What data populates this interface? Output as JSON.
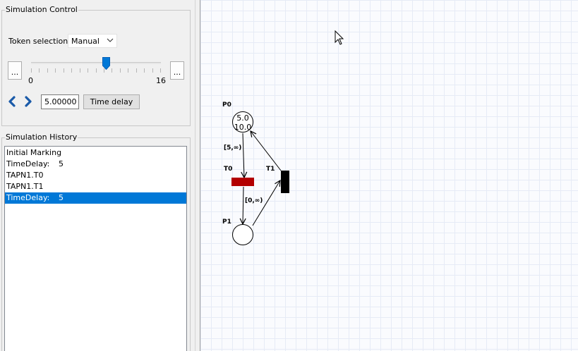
{
  "simulation_control": {
    "title": "Simulation Control",
    "token_selection_label": "Token selection:",
    "token_selection_value": "Manual",
    "slider": {
      "min_label": "0",
      "max_label": "16",
      "value_fraction": 0.58
    },
    "more_button_label": "...",
    "time_value": "5.00000",
    "time_delay_button": "Time delay"
  },
  "simulation_history": {
    "title": "Simulation History",
    "items": [
      {
        "name": "Initial Marking",
        "value": ""
      },
      {
        "name": "TimeDelay:",
        "value": "5"
      },
      {
        "name": "TAPN1.T0",
        "value": ""
      },
      {
        "name": "TAPN1.T1",
        "value": ""
      },
      {
        "name": "TimeDelay:",
        "value": "5",
        "selected": true
      }
    ]
  },
  "net": {
    "places": [
      {
        "label": "P0",
        "tokens": [
          "5.0",
          "10.0"
        ]
      },
      {
        "label": "P1",
        "tokens": []
      }
    ],
    "transitions": [
      {
        "label": "T0",
        "color": "#b30000",
        "enabled": true
      },
      {
        "label": "T1",
        "color": "#000000",
        "enabled": false
      }
    ],
    "arcs": [
      {
        "from": "P0",
        "to": "T0",
        "label": "[5,∞)"
      },
      {
        "from": "T0",
        "to": "P1",
        "label": "[0,∞)"
      },
      {
        "from": "P1",
        "to": "T1",
        "label": ""
      },
      {
        "from": "T1",
        "to": "P0",
        "label": ""
      }
    ]
  },
  "colors": {
    "selection": "#0078d7",
    "nav_arrow": "#1a5aa8",
    "enabled_transition": "#b30000"
  }
}
